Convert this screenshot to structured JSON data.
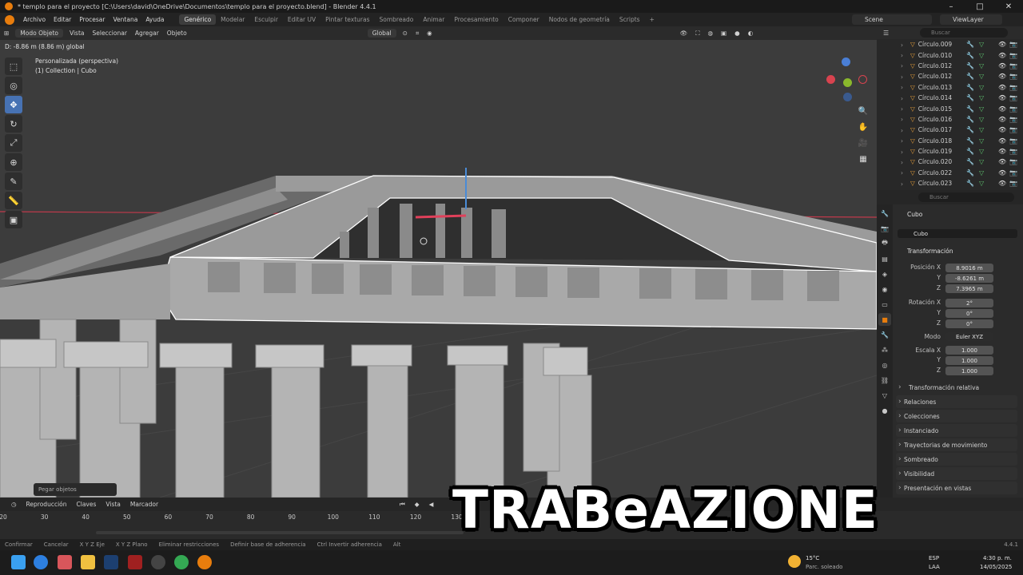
{
  "window": {
    "title": "* templo para el proyecto [C:\\Users\\david\\OneDrive\\Documentos\\templo para el proyecto.blend] - Blender 4.4.1",
    "controls": [
      "–",
      "□",
      "✕"
    ]
  },
  "menu": {
    "items": [
      "Archivo",
      "Editar",
      "Procesar",
      "Ventana",
      "Ayuda"
    ],
    "workspaces": [
      "Genérico",
      "Modelar",
      "Esculpir",
      "Editar UV",
      "Pintar texturas",
      "Sombreado",
      "Animar",
      "Procesamiento",
      "Componer",
      "Nodos de geometría",
      "Scripts",
      "+"
    ],
    "active_workspace": "Genérico",
    "scene": "Scene",
    "view_layer": "ViewLayer"
  },
  "viewport_header": {
    "mode": "Modo Objeto",
    "menus": [
      "Vista",
      "Seleccionar",
      "Agregar",
      "Objeto"
    ],
    "orientation": "Global"
  },
  "viewport": {
    "drag_info": "D: -8.86 m (8.86 m) global",
    "view_name": "Personalizada (perspectiva)",
    "collection": "(1) Collection | Cubo",
    "last_operation": "Pegar objetos",
    "gizmo_axes": [
      "X",
      "Y",
      "Z"
    ]
  },
  "tools": [
    "select-tool",
    "cursor-tool",
    "move-tool",
    "rotate-tool",
    "scale-tool",
    "transform-tool",
    "annotate-tool",
    "measure-tool",
    "add-cube-tool"
  ],
  "tool_glyphs": [
    "⬚",
    "◎",
    "✥",
    "↻",
    "⤢",
    "⊕",
    "✎",
    "📏",
    "▣"
  ],
  "outliner": {
    "search_placeholder": "Buscar",
    "items": [
      "Círculo.009",
      "Círculo.010",
      "Círculo.012",
      "Círculo.012",
      "Círculo.013",
      "Círculo.014",
      "Círculo.015",
      "Círculo.016",
      "Círculo.017",
      "Círculo.018",
      "Círculo.019",
      "Círculo.020",
      "Círculo.022",
      "Círculo.023",
      "Círculo.023"
    ]
  },
  "properties": {
    "search_placeholder": "Buscar",
    "object_name": "Cubo",
    "data_name": "Cubo",
    "transform_title": "Transformación",
    "location": {
      "label": "Posición X",
      "x": "8.9016 m",
      "y": "-8.6261 m",
      "z": "7.3965 m"
    },
    "rotation": {
      "label": "Rotación X",
      "x": "2°",
      "y": "0°",
      "z": "0°"
    },
    "mode_label": "Modo",
    "mode_value": "Euler XYZ",
    "scale": {
      "label": "Escala X",
      "x": "1.000",
      "y": "1.000",
      "z": "1.000"
    },
    "axis_y": "Y",
    "axis_z": "Z",
    "delta": "Transformación relativa",
    "sections": [
      "Relaciones",
      "Colecciones",
      "Instanciado",
      "Trayectorias de movimiento",
      "Sombreado",
      "Visibilidad",
      "Presentación en vistas"
    ]
  },
  "timeline": {
    "menus": [
      "Reproducción",
      "Claves",
      "Vista",
      "Marcador"
    ],
    "ticks": [
      "20",
      "30",
      "40",
      "50",
      "60",
      "70",
      "80",
      "90",
      "100",
      "110",
      "120",
      "130"
    ]
  },
  "statusbar": {
    "items": [
      "Confirmar",
      "Cancelar",
      "X Y Z Eje",
      "X Y Z Plano",
      "Eliminar restricciones",
      "Definir base de adherencia",
      "Ctrl Invertir adherencia",
      "Alt"
    ],
    "version": "4.4.1"
  },
  "taskbar": {
    "weather_temp": "15°C",
    "weather_desc": "Parc. soleado",
    "lang": "ESP",
    "lang2": "LAA",
    "time": "4:30 p. m.",
    "date": "14/05/2025"
  },
  "overlay_caption": "TRABeAZIONE",
  "colors": {
    "accent": "#4772b3",
    "blender_orange": "#e87d0d",
    "viewport_bg": "#3c3c3c"
  }
}
